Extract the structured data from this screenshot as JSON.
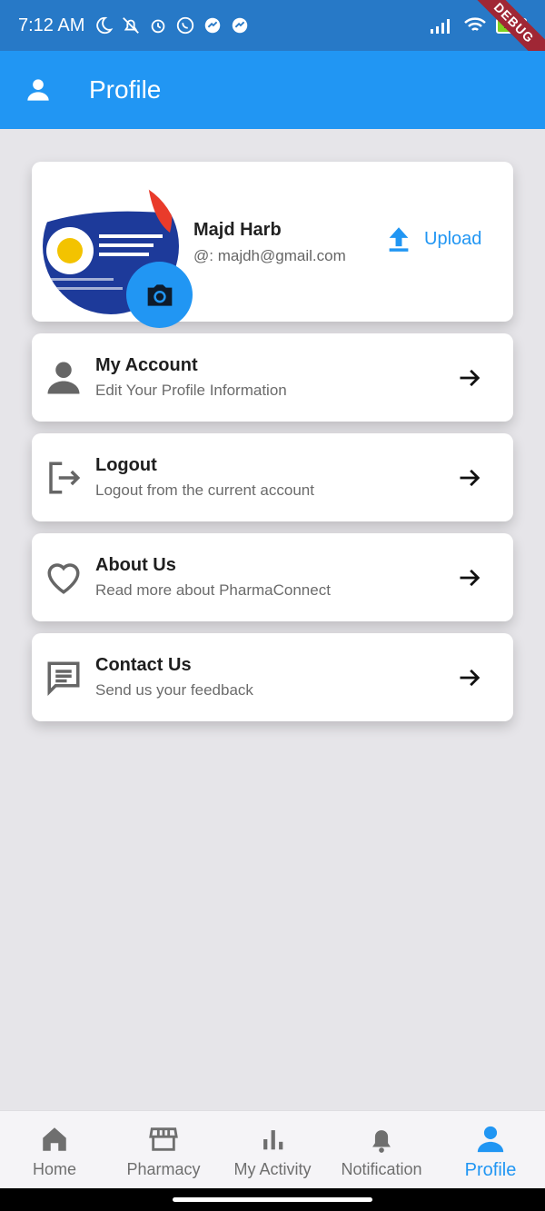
{
  "status_bar": {
    "time": "7:12 AM",
    "battery": "100",
    "debug_label": "DEBUG"
  },
  "app_bar": {
    "title": "Profile",
    "icon": "person-icon"
  },
  "profile": {
    "name": "Majd Harb",
    "email": "@: majdh@gmail.com",
    "upload_label": "Upload"
  },
  "menu": [
    {
      "title": "My Account",
      "subtitle": "Edit Your Profile Information",
      "icon": "person-icon"
    },
    {
      "title": "Logout",
      "subtitle": "Logout from the current account",
      "icon": "logout-icon"
    },
    {
      "title": "About Us",
      "subtitle": "Read more about PharmaConnect",
      "icon": "heart-icon"
    },
    {
      "title": "Contact Us",
      "subtitle": "Send us your feedback",
      "icon": "feedback-icon"
    }
  ],
  "bottom_nav": [
    {
      "label": "Home",
      "icon": "home-icon"
    },
    {
      "label": "Pharmacy",
      "icon": "store-icon"
    },
    {
      "label": "My Activity",
      "icon": "bar-chart-icon"
    },
    {
      "label": "Notification",
      "icon": "bell-icon"
    },
    {
      "label": "Profile",
      "icon": "person-icon",
      "active": true
    }
  ],
  "colors": {
    "primary": "#2196f3",
    "status_bar": "#2779c7",
    "background": "#e6e5e9"
  }
}
